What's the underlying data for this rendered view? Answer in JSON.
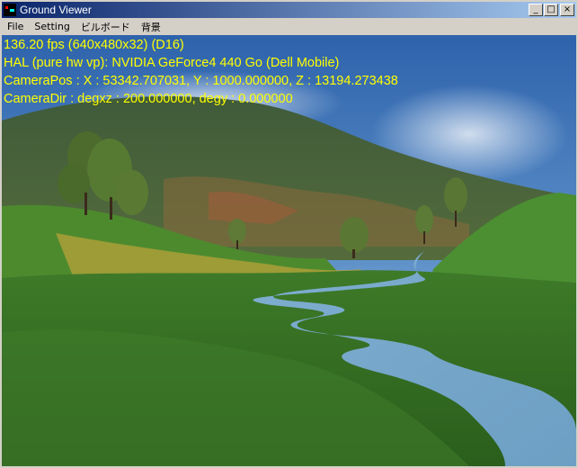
{
  "window": {
    "title": "Ground Viewer",
    "controls": {
      "minimize": "_",
      "maximize": "□",
      "close": "×"
    }
  },
  "menu": {
    "items": [
      "File",
      "Setting",
      "ビルボード",
      "背景"
    ]
  },
  "overlay": {
    "lines": [
      "136.20 fps (640x480x32) (D16)",
      "HAL (pure hw vp): NVIDIA GeForce4 440 Go (Dell Mobile)",
      "CameraPos : X : 53342.707031, Y : 1000.000000, Z : 13194.273438",
      "CameraDir : degxz : 200.000000, degy : 0.000000"
    ],
    "color": "#ffff00"
  },
  "scene": {
    "sky_color": "#3a6fb6",
    "grass_color": "#2f6a1f",
    "river_color": "#8ab4d8"
  }
}
